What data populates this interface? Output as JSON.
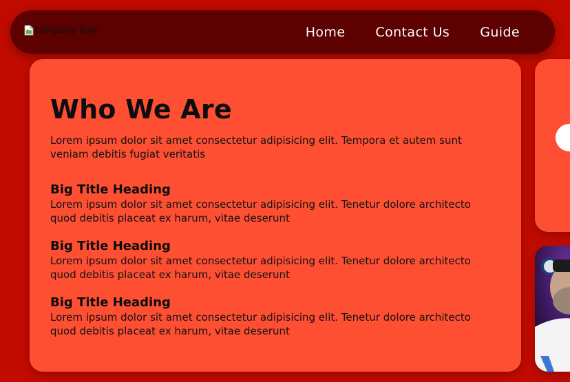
{
  "header": {
    "logo_alt": "company-logo",
    "nav": [
      {
        "label": "Home"
      },
      {
        "label": "Contact Us"
      },
      {
        "label": "Guide"
      }
    ]
  },
  "main": {
    "title": "Who We Are",
    "intro": "Lorem ipsum dolor sit amet consectetur adipisicing elit. Tempora et autem sunt veniam debitis fugiat veritatis",
    "sections": [
      {
        "heading": "Big Title Heading",
        "text": "Lorem ipsum dolor sit amet consectetur adipisicing elit. Tenetur dolore architecto quod debitis placeat ex harum, vitae deserunt"
      },
      {
        "heading": "Big Title Heading",
        "text": "Lorem ipsum dolor sit amet consectetur adipisicing elit. Tenetur dolore architecto quod debitis placeat ex harum, vitae deserunt"
      },
      {
        "heading": "Big Title Heading",
        "text": "Lorem ipsum dolor sit amet consectetur adipisicing elit. Tenetur dolore architecto quod debitis placeat ex harum, vitae deserunt"
      }
    ]
  },
  "colors": {
    "page_background": "#c10b00",
    "navbar": "#5c0000",
    "card": "#ff4f33",
    "text": "#111111"
  },
  "icons": {
    "broken_image": "broken-image-icon"
  }
}
